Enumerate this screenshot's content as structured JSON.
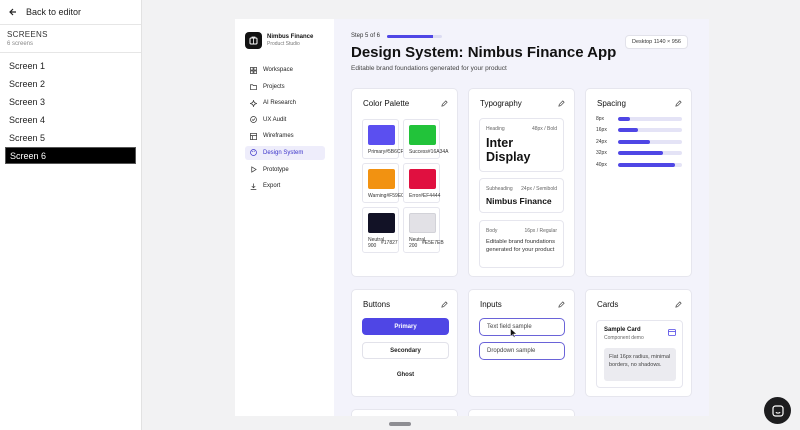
{
  "editor": {
    "back_label": "Back to editor",
    "screens_title": "SCREENS",
    "screens_count": "6 screens",
    "screens": [
      "Screen 1",
      "Screen 2",
      "Screen 3",
      "Screen 4",
      "Screen 5",
      "Screen 6"
    ],
    "active_screen": "Screen 6"
  },
  "app": {
    "brand_name": "Nimbus Finance",
    "brand_sub": "Product Studio",
    "nav": [
      {
        "label": "Workspace",
        "icon": "grid-icon"
      },
      {
        "label": "Projects",
        "icon": "folder-icon"
      },
      {
        "label": "AI Research",
        "icon": "sparkle-icon"
      },
      {
        "label": "UX Audit",
        "icon": "check-icon"
      },
      {
        "label": "Wireframes",
        "icon": "layout-icon"
      },
      {
        "label": "Design System",
        "icon": "palette-icon"
      },
      {
        "label": "Prototype",
        "icon": "play-icon"
      },
      {
        "label": "Export",
        "icon": "download-icon"
      }
    ],
    "active_nav": "Design System"
  },
  "header": {
    "step": "Step 5 of 6",
    "step_progress": 0.83,
    "title": "Design System: Nimbus Finance App",
    "subtitle": "Editable brand foundations generated for your product",
    "viewport": "Desktop 1140 × 956"
  },
  "color_palette": {
    "title": "Color Palette",
    "swatches": [
      {
        "name": "Primary",
        "hex": "#5B6CFF",
        "color": "#5b4ff0"
      },
      {
        "name": "Success",
        "hex": "#16A34A",
        "color": "#22c33a"
      },
      {
        "name": "Warning",
        "hex": "#F59E0B",
        "color": "#f29211"
      },
      {
        "name": "Error",
        "hex": "#EF4444",
        "color": "#e01040"
      },
      {
        "name": "Neutral 900",
        "hex": "#17827",
        "color": "#121226"
      },
      {
        "name": "Neutral 200",
        "hex": "#E5E7EB",
        "color": "#e2e1e6"
      }
    ]
  },
  "typography": {
    "title": "Typography",
    "heading": {
      "label": "Heading",
      "meta": "48px / Bold",
      "sample": "Inter Display"
    },
    "subheading": {
      "label": "Subheading",
      "meta": "24px / Semibold",
      "sample": "Nimbus Finance"
    },
    "body": {
      "label": "Body",
      "meta": "16px / Regular",
      "sample": "Editable brand foundations generated for your product"
    }
  },
  "spacing": {
    "title": "Spacing",
    "rows": [
      {
        "label": "8px",
        "fill": 0.19
      },
      {
        "label": "16px",
        "fill": 0.32
      },
      {
        "label": "24px",
        "fill": 0.5
      },
      {
        "label": "32px",
        "fill": 0.71
      },
      {
        "label": "40px",
        "fill": 0.89
      }
    ]
  },
  "buttons": {
    "title": "Buttons",
    "primary": "Primary",
    "secondary": "Secondary",
    "ghost": "Ghost"
  },
  "inputs": {
    "title": "Inputs",
    "text_field": "Text field sample",
    "dropdown": "Dropdown sample"
  },
  "cards": {
    "title": "Cards",
    "sample_title": "Sample Card",
    "sample_sub": "Component demo",
    "sample_body": "Flat 16px radius, minimal borders, no shadows."
  }
}
